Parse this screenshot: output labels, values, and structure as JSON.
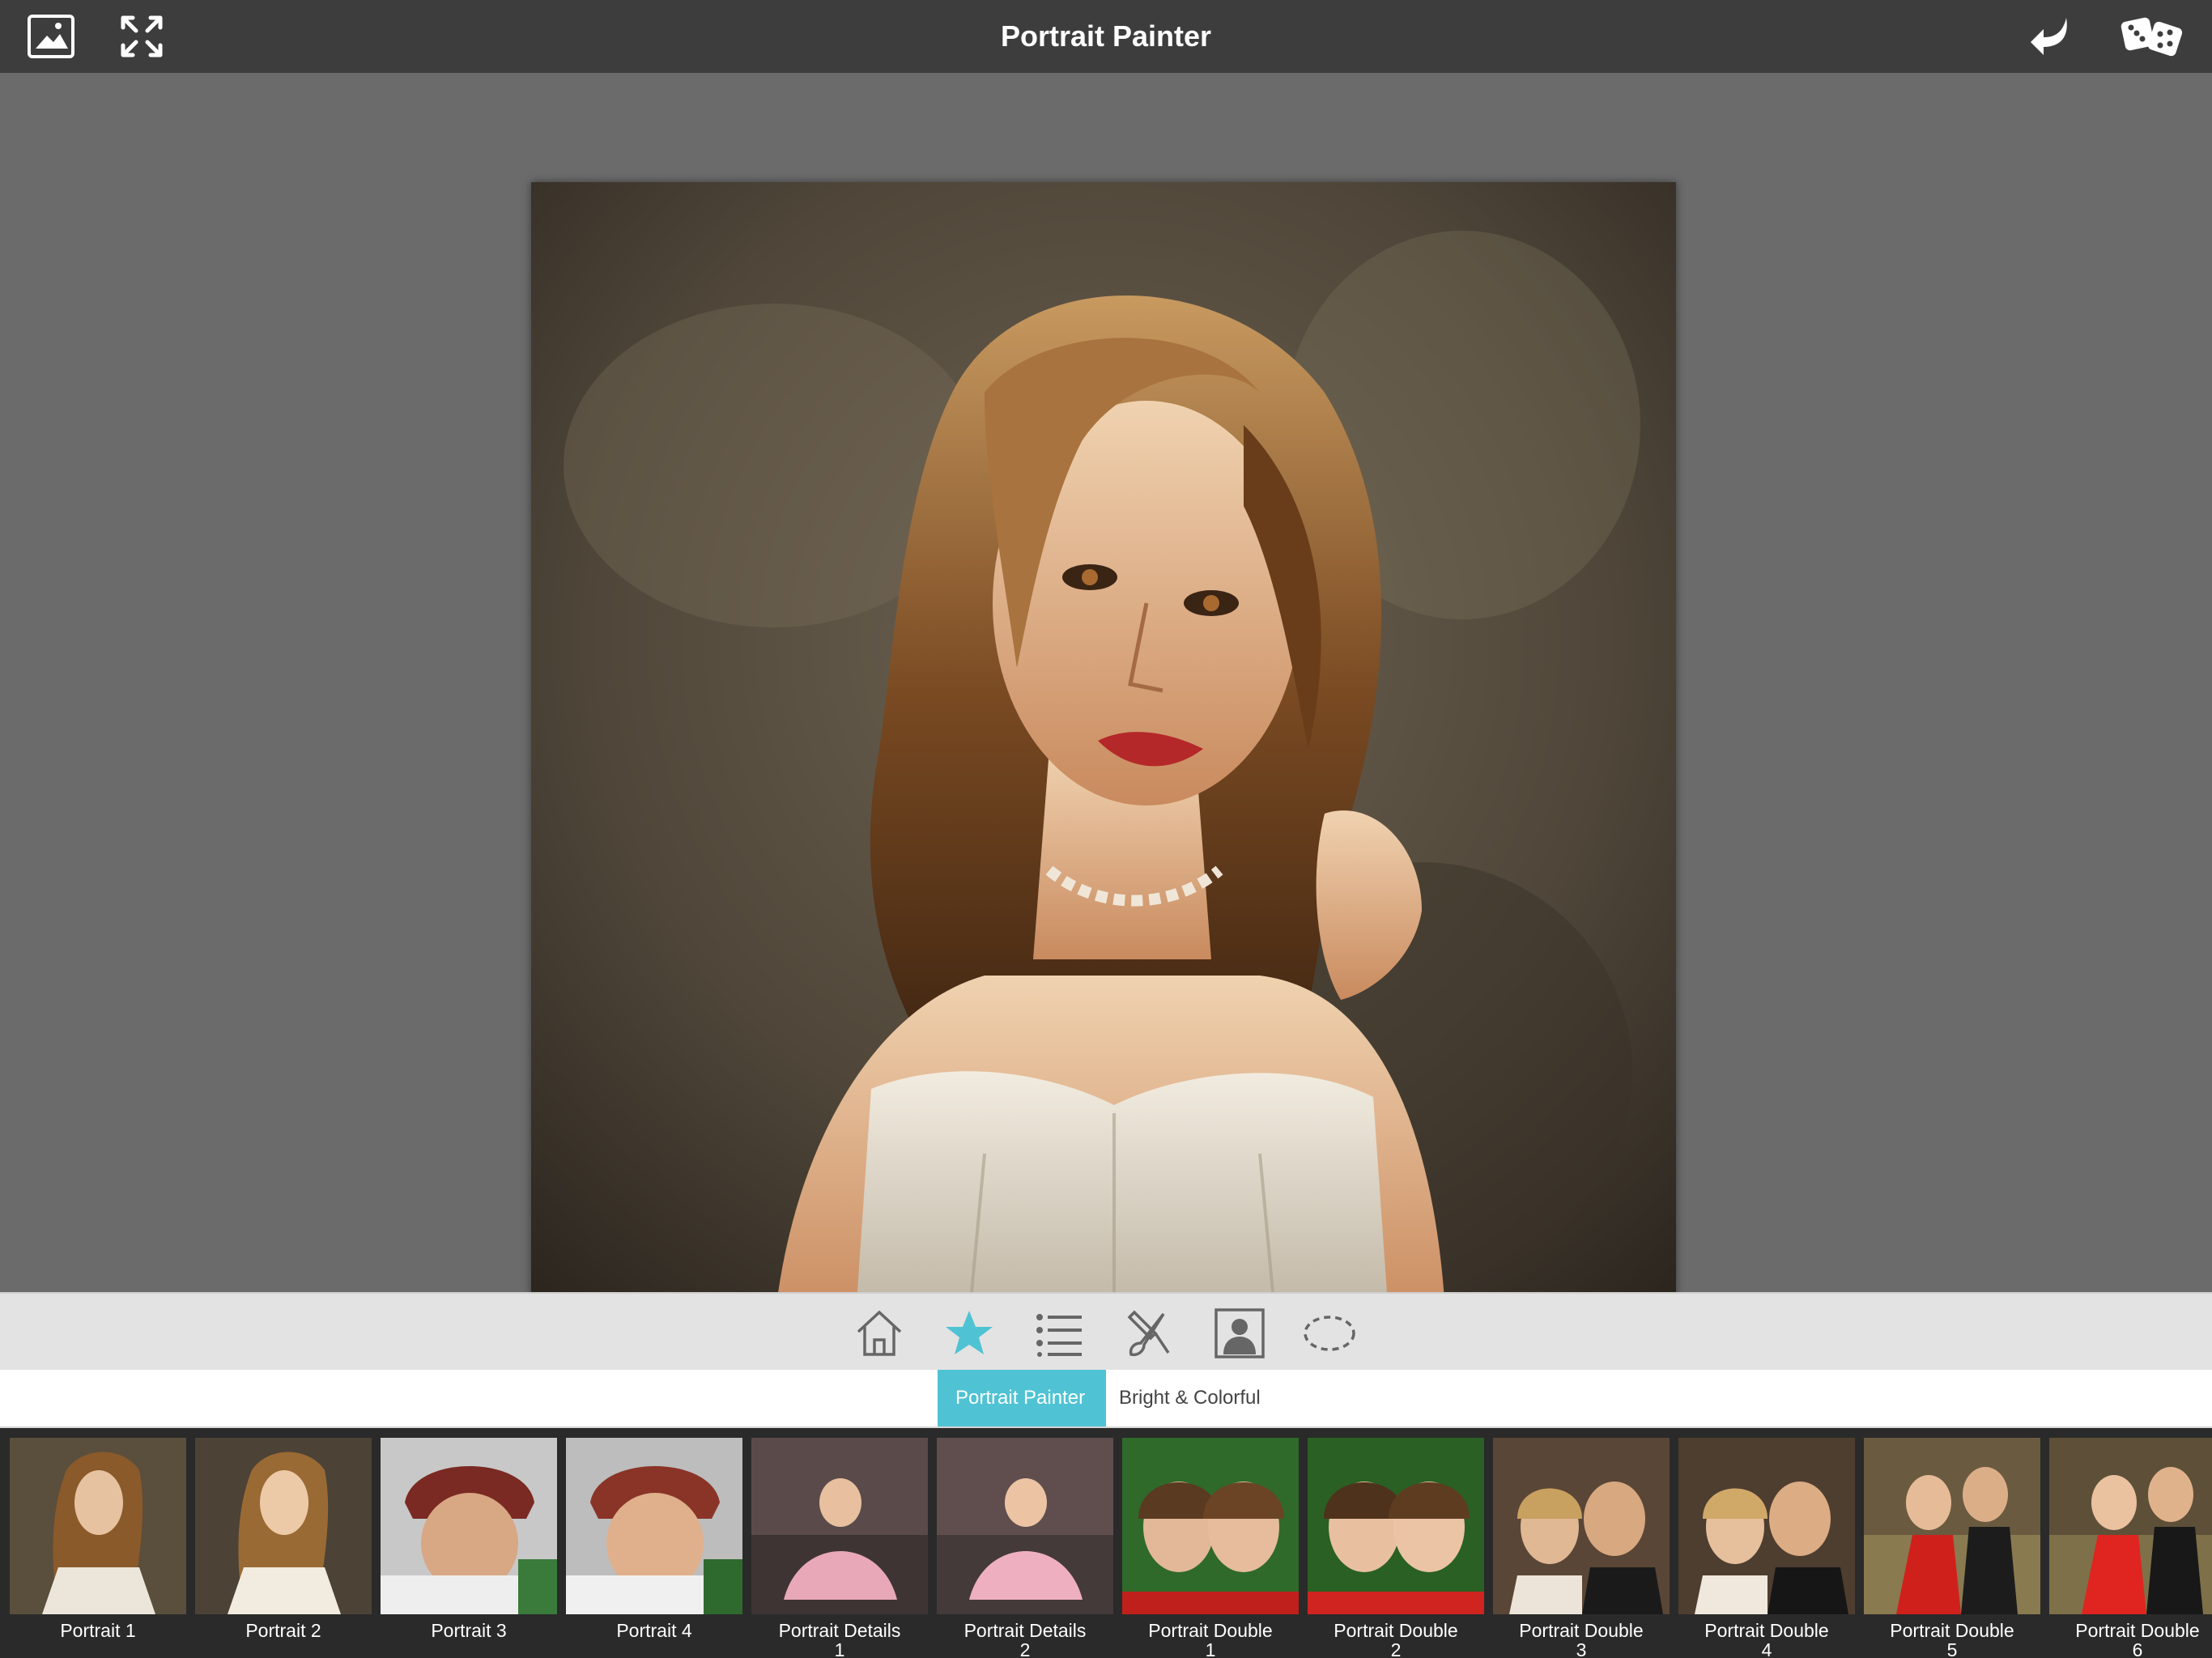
{
  "app": {
    "title": "Portrait Painter"
  },
  "icons": {
    "gallery": "image-gallery-icon",
    "fullscreen": "fullscreen-icon",
    "undo": "undo-arrow-icon",
    "random": "dice-icon"
  },
  "toolbar": {
    "items": [
      "home-icon",
      "star-icon",
      "list-icon",
      "paint-tools-icon",
      "portrait-icon",
      "lasso-icon"
    ],
    "active": "star-icon",
    "accent": "#4fc3d3"
  },
  "tabs": [
    {
      "label": "Portrait Painter",
      "active": true
    },
    {
      "label": "Bright & Colorful",
      "active": false
    }
  ],
  "presets": [
    {
      "line1": "Portrait 1",
      "line2": ""
    },
    {
      "line1": "Portrait 2",
      "line2": ""
    },
    {
      "line1": "Portrait 3",
      "line2": ""
    },
    {
      "line1": "Portrait 4",
      "line2": ""
    },
    {
      "line1": "Portrait Details",
      "line2": "1"
    },
    {
      "line1": "Portrait Details",
      "line2": "2"
    },
    {
      "line1": "Portrait Double",
      "line2": "1"
    },
    {
      "line1": "Portrait Double",
      "line2": "2"
    },
    {
      "line1": "Portrait Double",
      "line2": "3"
    },
    {
      "line1": "Portrait Double",
      "line2": "4"
    },
    {
      "line1": "Portrait Double",
      "line2": "5"
    },
    {
      "line1": "Portrait Double",
      "line2": "6"
    }
  ]
}
